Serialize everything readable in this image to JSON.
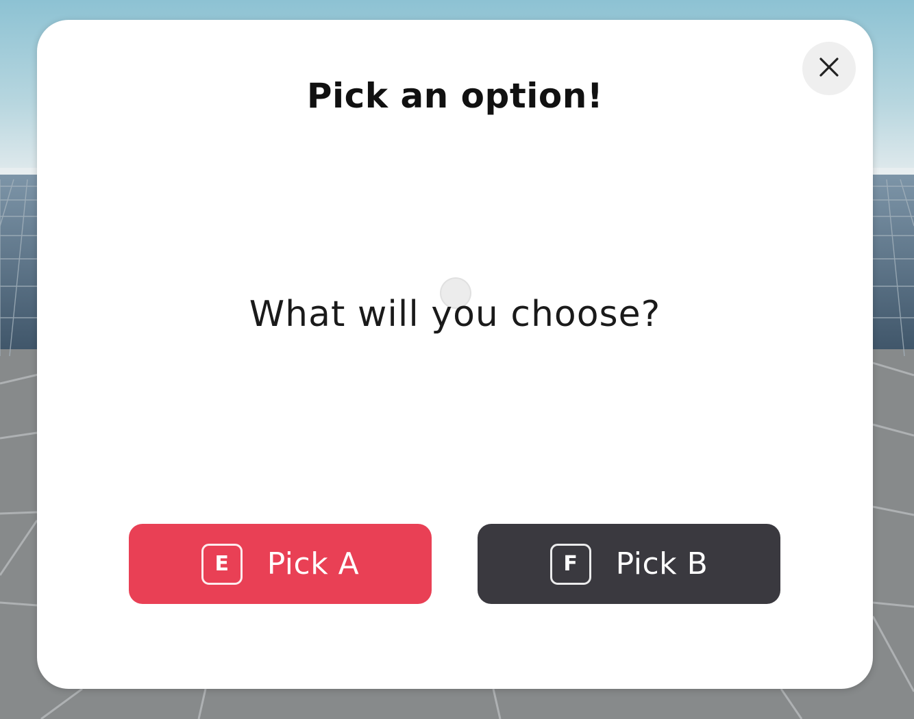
{
  "dialog": {
    "title": "Pick an option!",
    "prompt": "What will you choose?",
    "close_icon": "close-icon"
  },
  "options": [
    {
      "key": "E",
      "label": "Pick A",
      "color": "#e94055"
    },
    {
      "key": "F",
      "label": "Pick B",
      "color": "#3a393f"
    }
  ]
}
